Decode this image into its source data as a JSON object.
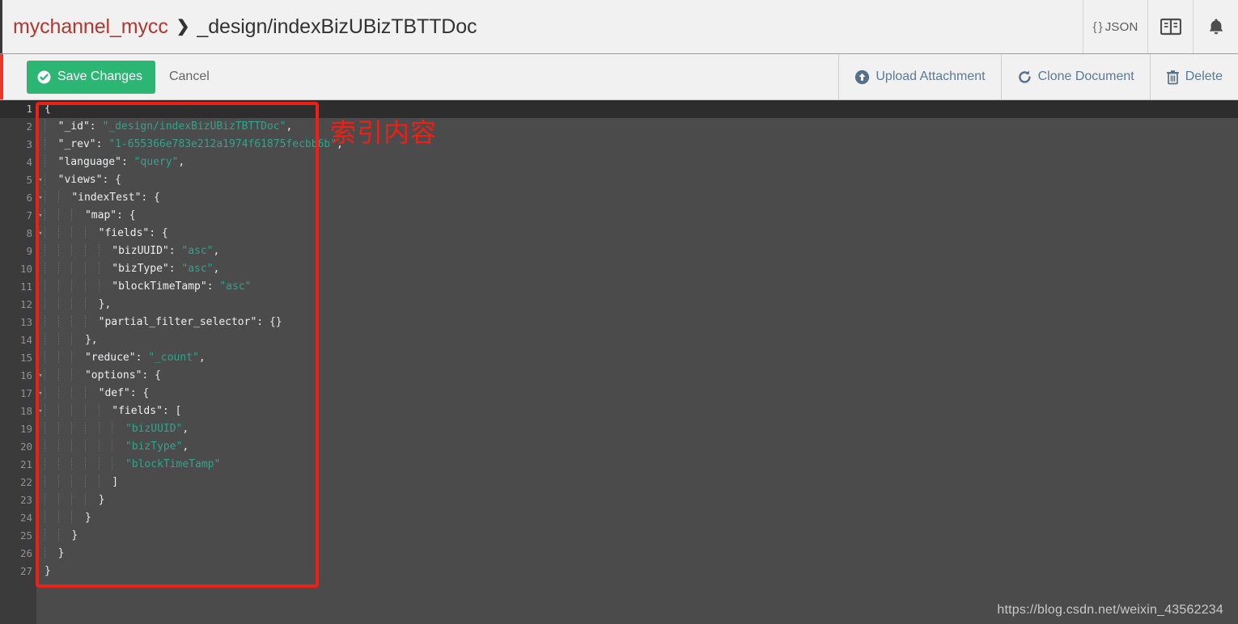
{
  "header": {
    "breadcrumb": {
      "database": "mychannel_mycc",
      "separator": "❯",
      "document": "_design/indexBizUBizTBTTDoc"
    },
    "actions": [
      {
        "name": "json-view-button",
        "label": "JSON",
        "prefix": "{ }",
        "icon": "json-braces-icon"
      },
      {
        "name": "documentation-button",
        "label": "",
        "icon": "book-icon"
      },
      {
        "name": "notifications-button",
        "label": "",
        "icon": "bell-icon"
      }
    ]
  },
  "toolbar": {
    "save_label": "Save Changes",
    "save_icon": "check-circle-icon",
    "cancel_label": "Cancel",
    "right_buttons": [
      {
        "name": "upload-attachment-button",
        "label": "Upload Attachment",
        "icon": "upload-circle-icon"
      },
      {
        "name": "clone-document-button",
        "label": "Clone Document",
        "icon": "clone-refresh-icon"
      },
      {
        "name": "delete-document-button",
        "label": "Delete",
        "icon": "trash-icon"
      }
    ]
  },
  "editor": {
    "active_line": 1,
    "fold_lines": [
      1,
      5,
      6,
      7,
      8,
      16,
      17,
      18
    ],
    "line_numbers": [
      1,
      2,
      3,
      4,
      5,
      6,
      7,
      8,
      9,
      10,
      11,
      12,
      13,
      14,
      15,
      16,
      17,
      18,
      19,
      20,
      21,
      22,
      23,
      24,
      25,
      26,
      27
    ],
    "document": {
      "_id": "_design/indexBizUBizTBTTDoc",
      "_rev": "1-655366e783e212a1974f61875fecbb6b",
      "language": "query",
      "views": {
        "indexTest": {
          "map": {
            "fields": {
              "bizUUID": "asc",
              "bizType": "asc",
              "blockTimeTamp": "asc"
            },
            "partial_filter_selector": {}
          },
          "reduce": "_count",
          "options": {
            "def": {
              "fields": [
                "bizUUID",
                "bizType",
                "blockTimeTamp"
              ]
            }
          }
        }
      }
    },
    "lines": [
      {
        "n": 1,
        "indent": 0,
        "html": "<span class=\"tok-punct\">{</span>"
      },
      {
        "n": 2,
        "indent": 1,
        "html": "<span class=\"tok-key\">\"_id\"</span><span class=\"tok-punct\">: </span><span class=\"tok-str\">\"_design/indexBizUBizTBTTDoc\"</span><span class=\"tok-punct\">,</span>"
      },
      {
        "n": 3,
        "indent": 1,
        "html": "<span class=\"tok-key\">\"_rev\"</span><span class=\"tok-punct\">: </span><span class=\"tok-str\">\"1-655366e783e212a1974f61875fecbb6b\"</span><span class=\"tok-punct\">,</span>"
      },
      {
        "n": 4,
        "indent": 1,
        "html": "<span class=\"tok-key\">\"language\"</span><span class=\"tok-punct\">: </span><span class=\"tok-str\">\"query\"</span><span class=\"tok-punct\">,</span>"
      },
      {
        "n": 5,
        "indent": 1,
        "html": "<span class=\"tok-key\">\"views\"</span><span class=\"tok-punct\">: {</span>"
      },
      {
        "n": 6,
        "indent": 2,
        "html": "<span class=\"tok-key\">\"indexTest\"</span><span class=\"tok-punct\">: {</span>"
      },
      {
        "n": 7,
        "indent": 3,
        "html": "<span class=\"tok-key\">\"map\"</span><span class=\"tok-punct\">: {</span>"
      },
      {
        "n": 8,
        "indent": 4,
        "html": "<span class=\"tok-key\">\"fields\"</span><span class=\"tok-punct\">: {</span>"
      },
      {
        "n": 9,
        "indent": 5,
        "html": "<span class=\"tok-key\">\"bizUUID\"</span><span class=\"tok-punct\">: </span><span class=\"tok-str\">\"asc\"</span><span class=\"tok-punct\">,</span>"
      },
      {
        "n": 10,
        "indent": 5,
        "html": "<span class=\"tok-key\">\"bizType\"</span><span class=\"tok-punct\">: </span><span class=\"tok-str\">\"asc\"</span><span class=\"tok-punct\">,</span>"
      },
      {
        "n": 11,
        "indent": 5,
        "html": "<span class=\"tok-key\">\"blockTimeTamp\"</span><span class=\"tok-punct\">: </span><span class=\"tok-str\">\"asc\"</span>"
      },
      {
        "n": 12,
        "indent": 4,
        "html": "<span class=\"tok-punct\">},</span>"
      },
      {
        "n": 13,
        "indent": 4,
        "html": "<span class=\"tok-key\">\"partial_filter_selector\"</span><span class=\"tok-punct\">: {}</span>"
      },
      {
        "n": 14,
        "indent": 3,
        "html": "<span class=\"tok-punct\">},</span>"
      },
      {
        "n": 15,
        "indent": 3,
        "html": "<span class=\"tok-key\">\"reduce\"</span><span class=\"tok-punct\">: </span><span class=\"tok-str\">\"_count\"</span><span class=\"tok-punct\">,</span>"
      },
      {
        "n": 16,
        "indent": 3,
        "html": "<span class=\"tok-key\">\"options\"</span><span class=\"tok-punct\">: {</span>"
      },
      {
        "n": 17,
        "indent": 4,
        "html": "<span class=\"tok-key\">\"def\"</span><span class=\"tok-punct\">: {</span>"
      },
      {
        "n": 18,
        "indent": 5,
        "html": "<span class=\"tok-key\">\"fields\"</span><span class=\"tok-punct\">: [</span>"
      },
      {
        "n": 19,
        "indent": 6,
        "html": "<span class=\"tok-str\">\"bizUUID\"</span><span class=\"tok-punct\">,</span>"
      },
      {
        "n": 20,
        "indent": 6,
        "html": "<span class=\"tok-str\">\"bizType\"</span><span class=\"tok-punct\">,</span>"
      },
      {
        "n": 21,
        "indent": 6,
        "html": "<span class=\"tok-str\">\"blockTimeTamp\"</span>"
      },
      {
        "n": 22,
        "indent": 5,
        "html": "<span class=\"tok-punct\">]</span>"
      },
      {
        "n": 23,
        "indent": 4,
        "html": "<span class=\"tok-punct\">}</span>"
      },
      {
        "n": 24,
        "indent": 3,
        "html": "<span class=\"tok-punct\">}</span>"
      },
      {
        "n": 25,
        "indent": 2,
        "html": "<span class=\"tok-punct\">}</span>"
      },
      {
        "n": 26,
        "indent": 1,
        "html": "<span class=\"tok-punct\">}</span>"
      },
      {
        "n": 27,
        "indent": 0,
        "html": "<span class=\"tok-punct\">}</span>"
      }
    ]
  },
  "annotation": {
    "text": "索引内容",
    "color": "#f01f16"
  },
  "watermark": "https://blog.csdn.net/weixin_43562234",
  "colors": {
    "header_bg": "#f1f1f1",
    "accent_green": "#2bb673",
    "breadcrumb_db": "#b33630",
    "editor_bg": "#4b4b4b",
    "gutter_bg": "#3b3b3b",
    "active_line_bg": "#2d2d2d",
    "string_token": "#31a48c",
    "key_token": "#eceff1",
    "annotation_red": "#f01f16"
  }
}
